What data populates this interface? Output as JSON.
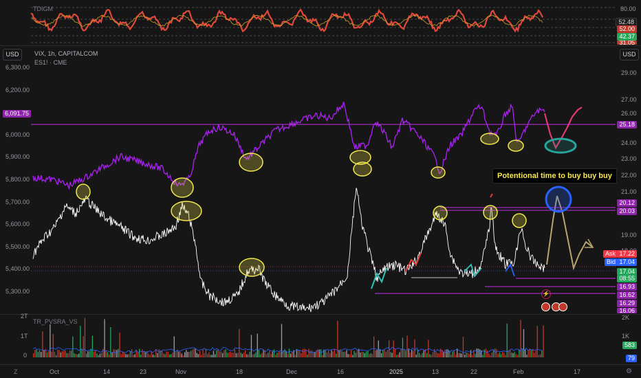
{
  "top_pane": {
    "indicator_label": "TDIGM",
    "scale": [
      "80.00",
      "52.48",
      "52.00",
      "42.37",
      "31.05"
    ]
  },
  "main_pane": {
    "currency_left": "USD",
    "currency_right": "USD",
    "symbol_line": "VIX, 1h, CAPITALCOM",
    "overlay_line": "ES1! · CME",
    "left_scale": [
      "6,300.00",
      "6,200.00",
      "6,100.00",
      "6,000.00",
      "5,900.00",
      "5,800.00",
      "5,700.00",
      "5,600.00",
      "5,500.00",
      "5,400.00",
      "5,300.00"
    ],
    "left_price_tag": "6,091.75",
    "right_scale": [
      "29.00",
      "27.00",
      "26.00",
      "25.18",
      "24.00",
      "23.00",
      "22.00",
      "21.00",
      "20.12",
      "20.03",
      "19.00",
      "18.00",
      "17.22",
      "17.04",
      "17.04",
      "08:55",
      "16.93",
      "16.62",
      "16.29",
      "16.06"
    ],
    "ask_label": "Ask",
    "bid_label": "Bid",
    "callout": "Potentional time to buy buy buy"
  },
  "volume_pane": {
    "indicator_label": "TR_PVSRA_VS",
    "scale": [
      "2T",
      "2K",
      "1T",
      "1K",
      "0"
    ],
    "tag_green": "583",
    "tag_blue": "79"
  },
  "time_axis": [
    "Oct",
    "14",
    "23",
    "Nov",
    "18",
    "Dec",
    "16",
    "2025",
    "13",
    "22",
    "Feb",
    "17"
  ],
  "colors": {
    "background": "#161616",
    "es_line": "#a321e8",
    "vix_line": "#ffffff",
    "oscillator": "#e0483c",
    "level_magenta": "#c22ee6",
    "ask": "#f23645",
    "bid": "#2962ff",
    "green_tag": "#26a65b",
    "highlight_yellow": "#f2e850"
  },
  "icons": {
    "zoom_out": "zoom-out-icon",
    "settings": "gear-icon",
    "flash": "lightning-icon",
    "events": "flag-icon"
  }
}
